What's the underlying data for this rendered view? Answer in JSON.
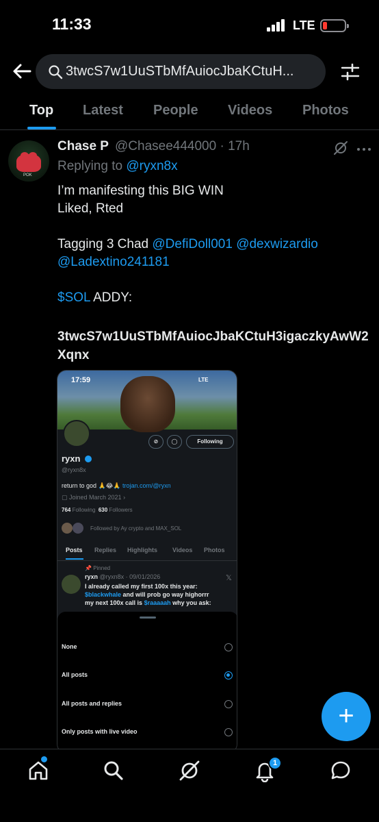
{
  "status_bar": {
    "time": "11:33",
    "network": "LTE"
  },
  "search": {
    "query": "3twcS7w1UuSTbMfAuiocJbaKCtuH..."
  },
  "tabs": [
    {
      "label": "Top",
      "active": true
    },
    {
      "label": "Latest",
      "active": false
    },
    {
      "label": "People",
      "active": false
    },
    {
      "label": "Videos",
      "active": false
    },
    {
      "label": "Photos",
      "active": false
    }
  ],
  "tweet": {
    "name": "Chase P",
    "handle_time": "@Chasee444000 · 17h",
    "replying_label": "Replying to",
    "replying_to": "@ryxn8x",
    "line1": "I’m manifesting this BIG WIN",
    "line2": "Liked, Rted",
    "tagging_label": "Tagging 3 Chad",
    "mention1": "@DefiDoll001",
    "mention2": "@dexwizardio",
    "mention3": "@Ladextino241181",
    "cashtag": "$SOL",
    "addy_label": "ADDY:",
    "contract_address": "3twcS7w1UuSTbMfAuiocJbaKCtuH3igaczkyAwW2Xqnx"
  },
  "embedded": {
    "time": "17:59",
    "network": "LTE",
    "follow_button": "Following",
    "name": "ryxn",
    "handle": "@ryxn8x",
    "bio_text": "return to god",
    "bio_link": "trojan.com/@ryxn",
    "joined": "Joined March 2021",
    "following_count": "764",
    "following_label": "Following",
    "followers_count": "630",
    "followers_label": "Followers",
    "followed_by": "Followed by Ay crypto and MAX_SOL",
    "tabs": [
      "Posts",
      "Replies",
      "Highlights",
      "Videos",
      "Photos"
    ],
    "pinned": "Pinned",
    "post_name": "ryxn",
    "post_meta": "@ryxn8x · 09/01/2026",
    "post_line1": "I already called my first 100x this year:",
    "post_cashtag1": "$blackwhale",
    "post_line2": " and will prob go way highorrr",
    "post_line3": "my next 100x call is ",
    "post_cashtag2": "$raaaaah",
    "post_line4": " why you ask:",
    "notify_options": [
      {
        "label": "None",
        "selected": false
      },
      {
        "label": "All posts",
        "selected": true
      },
      {
        "label": "All posts and replies",
        "selected": false
      },
      {
        "label": "Only posts with live video",
        "selected": false
      }
    ]
  },
  "nav": {
    "notification_count": "1"
  },
  "colors": {
    "accent": "#1d9bf0",
    "background": "#000000",
    "text": "#e7e9ea",
    "muted": "#71767b"
  }
}
